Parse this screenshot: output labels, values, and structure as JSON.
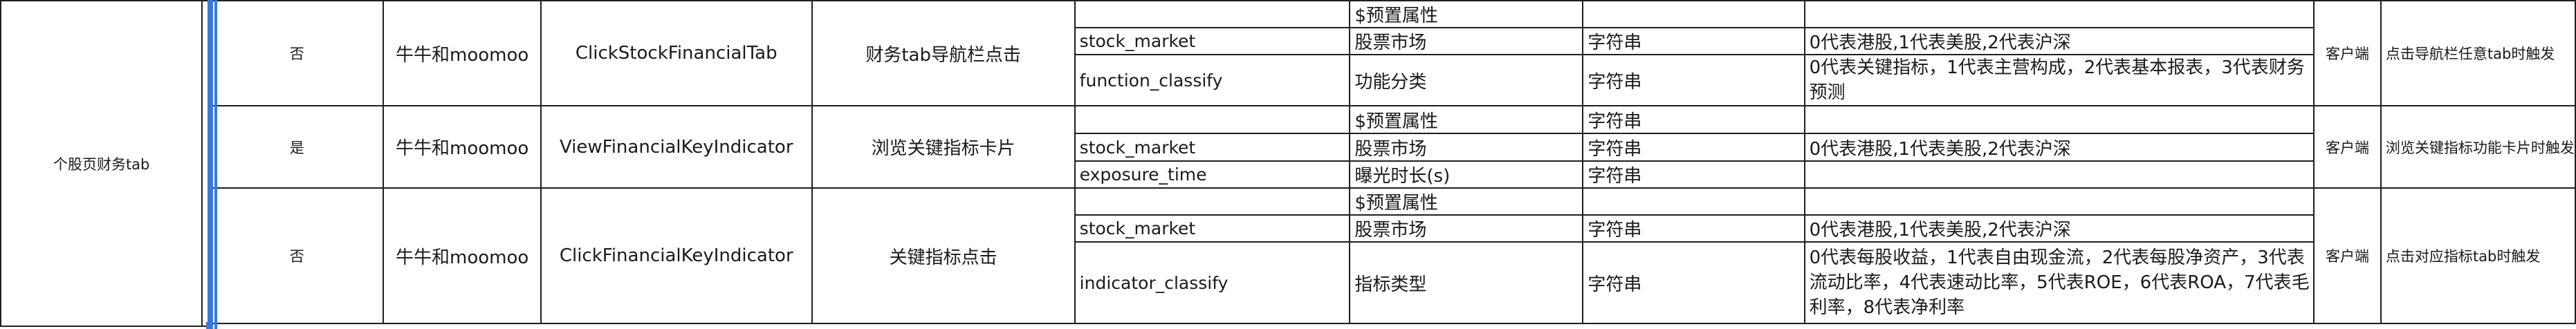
{
  "section_label": "个股页财务tab",
  "accent_color": "#3a78d8",
  "events": [
    {
      "preset": "否",
      "app": "牛牛和moomoo",
      "event_name": "ClickStockFinancialTab",
      "event_desc": "财务tab导航栏点击",
      "client": "客户端",
      "trigger": "点击导航栏任意tab时触发",
      "properties": [
        {
          "key": "",
          "name": "$预置属性",
          "type": "",
          "note": ""
        },
        {
          "key": "stock_market",
          "name": "股票市场",
          "type": "字符串",
          "note": "0代表港股,1代表美股,2代表沪深"
        },
        {
          "key": "function_classify",
          "name": "功能分类",
          "type": "字符串",
          "note": "0代表关键指标，1代表主营构成，2代表基本报表，3代表财务预测"
        }
      ]
    },
    {
      "preset": "是",
      "app": "牛牛和moomoo",
      "event_name": "ViewFinancialKeyIndicator",
      "event_desc": "浏览关键指标卡片",
      "client": "客户端",
      "trigger": "浏览关键指标功能卡片时触发",
      "properties": [
        {
          "key": "",
          "name": "$预置属性",
          "type": "字符串",
          "note": ""
        },
        {
          "key": "stock_market",
          "name": "股票市场",
          "type": "字符串",
          "note": "0代表港股,1代表美股,2代表沪深"
        },
        {
          "key": "exposure_time",
          "name": "曝光时长(s)",
          "type": "字符串",
          "note": ""
        }
      ]
    },
    {
      "preset": "否",
      "app": "牛牛和moomoo",
      "event_name": "ClickFinancialKeyIndicator",
      "event_desc": "关键指标点击",
      "client": "客户端",
      "trigger": "点击对应指标tab时触发",
      "properties": [
        {
          "key": "",
          "name": "$预置属性",
          "type": "",
          "note": ""
        },
        {
          "key": "stock_market",
          "name": "股票市场",
          "type": "字符串",
          "note": "0代表港股,1代表美股,2代表沪深"
        },
        {
          "key": "indicator_classify",
          "name": "指标类型",
          "type": "字符串",
          "note": "0代表每股收益，1代表自由现金流，2代表每股净资产，3代表流动比率，4代表速动比率，5代表ROE，6代表ROA，7代表毛利率，8代表净利率"
        }
      ]
    }
  ]
}
